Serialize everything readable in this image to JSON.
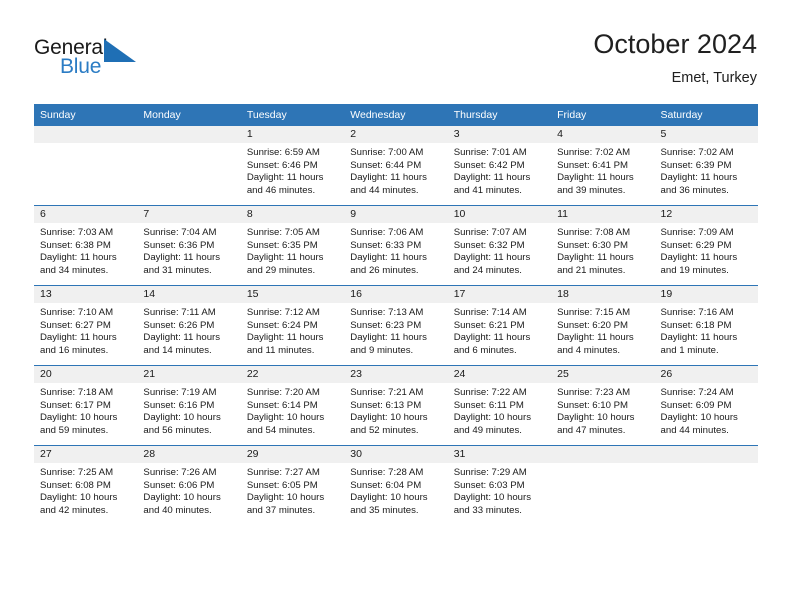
{
  "logo": {
    "word1": "General",
    "word2": "Blue",
    "triangle_color": "#1f6fb5",
    "word1_color": "#1a1a1a",
    "word2_color": "#2b7cc4"
  },
  "header": {
    "title": "October 2024",
    "subtitle": "Emet, Turkey"
  },
  "theme": {
    "header_blue": "#2e75b6",
    "daynum_band": "#f0f0f0",
    "text": "#1a1a1a"
  },
  "columns": [
    "Sunday",
    "Monday",
    "Tuesday",
    "Wednesday",
    "Thursday",
    "Friday",
    "Saturday"
  ],
  "weeks": [
    [
      {
        "day": "",
        "blank": true
      },
      {
        "day": "",
        "blank": true
      },
      {
        "day": "1",
        "sunrise": "Sunrise: 6:59 AM",
        "sunset": "Sunset: 6:46 PM",
        "daylight": "Daylight: 11 hours and 46 minutes."
      },
      {
        "day": "2",
        "sunrise": "Sunrise: 7:00 AM",
        "sunset": "Sunset: 6:44 PM",
        "daylight": "Daylight: 11 hours and 44 minutes."
      },
      {
        "day": "3",
        "sunrise": "Sunrise: 7:01 AM",
        "sunset": "Sunset: 6:42 PM",
        "daylight": "Daylight: 11 hours and 41 minutes."
      },
      {
        "day": "4",
        "sunrise": "Sunrise: 7:02 AM",
        "sunset": "Sunset: 6:41 PM",
        "daylight": "Daylight: 11 hours and 39 minutes."
      },
      {
        "day": "5",
        "sunrise": "Sunrise: 7:02 AM",
        "sunset": "Sunset: 6:39 PM",
        "daylight": "Daylight: 11 hours and 36 minutes."
      }
    ],
    [
      {
        "day": "6",
        "sunrise": "Sunrise: 7:03 AM",
        "sunset": "Sunset: 6:38 PM",
        "daylight": "Daylight: 11 hours and 34 minutes."
      },
      {
        "day": "7",
        "sunrise": "Sunrise: 7:04 AM",
        "sunset": "Sunset: 6:36 PM",
        "daylight": "Daylight: 11 hours and 31 minutes."
      },
      {
        "day": "8",
        "sunrise": "Sunrise: 7:05 AM",
        "sunset": "Sunset: 6:35 PM",
        "daylight": "Daylight: 11 hours and 29 minutes."
      },
      {
        "day": "9",
        "sunrise": "Sunrise: 7:06 AM",
        "sunset": "Sunset: 6:33 PM",
        "daylight": "Daylight: 11 hours and 26 minutes."
      },
      {
        "day": "10",
        "sunrise": "Sunrise: 7:07 AM",
        "sunset": "Sunset: 6:32 PM",
        "daylight": "Daylight: 11 hours and 24 minutes."
      },
      {
        "day": "11",
        "sunrise": "Sunrise: 7:08 AM",
        "sunset": "Sunset: 6:30 PM",
        "daylight": "Daylight: 11 hours and 21 minutes."
      },
      {
        "day": "12",
        "sunrise": "Sunrise: 7:09 AM",
        "sunset": "Sunset: 6:29 PM",
        "daylight": "Daylight: 11 hours and 19 minutes."
      }
    ],
    [
      {
        "day": "13",
        "sunrise": "Sunrise: 7:10 AM",
        "sunset": "Sunset: 6:27 PM",
        "daylight": "Daylight: 11 hours and 16 minutes."
      },
      {
        "day": "14",
        "sunrise": "Sunrise: 7:11 AM",
        "sunset": "Sunset: 6:26 PM",
        "daylight": "Daylight: 11 hours and 14 minutes."
      },
      {
        "day": "15",
        "sunrise": "Sunrise: 7:12 AM",
        "sunset": "Sunset: 6:24 PM",
        "daylight": "Daylight: 11 hours and 11 minutes."
      },
      {
        "day": "16",
        "sunrise": "Sunrise: 7:13 AM",
        "sunset": "Sunset: 6:23 PM",
        "daylight": "Daylight: 11 hours and 9 minutes."
      },
      {
        "day": "17",
        "sunrise": "Sunrise: 7:14 AM",
        "sunset": "Sunset: 6:21 PM",
        "daylight": "Daylight: 11 hours and 6 minutes."
      },
      {
        "day": "18",
        "sunrise": "Sunrise: 7:15 AM",
        "sunset": "Sunset: 6:20 PM",
        "daylight": "Daylight: 11 hours and 4 minutes."
      },
      {
        "day": "19",
        "sunrise": "Sunrise: 7:16 AM",
        "sunset": "Sunset: 6:18 PM",
        "daylight": "Daylight: 11 hours and 1 minute."
      }
    ],
    [
      {
        "day": "20",
        "sunrise": "Sunrise: 7:18 AM",
        "sunset": "Sunset: 6:17 PM",
        "daylight": "Daylight: 10 hours and 59 minutes."
      },
      {
        "day": "21",
        "sunrise": "Sunrise: 7:19 AM",
        "sunset": "Sunset: 6:16 PM",
        "daylight": "Daylight: 10 hours and 56 minutes."
      },
      {
        "day": "22",
        "sunrise": "Sunrise: 7:20 AM",
        "sunset": "Sunset: 6:14 PM",
        "daylight": "Daylight: 10 hours and 54 minutes."
      },
      {
        "day": "23",
        "sunrise": "Sunrise: 7:21 AM",
        "sunset": "Sunset: 6:13 PM",
        "daylight": "Daylight: 10 hours and 52 minutes."
      },
      {
        "day": "24",
        "sunrise": "Sunrise: 7:22 AM",
        "sunset": "Sunset: 6:11 PM",
        "daylight": "Daylight: 10 hours and 49 minutes."
      },
      {
        "day": "25",
        "sunrise": "Sunrise: 7:23 AM",
        "sunset": "Sunset: 6:10 PM",
        "daylight": "Daylight: 10 hours and 47 minutes."
      },
      {
        "day": "26",
        "sunrise": "Sunrise: 7:24 AM",
        "sunset": "Sunset: 6:09 PM",
        "daylight": "Daylight: 10 hours and 44 minutes."
      }
    ],
    [
      {
        "day": "27",
        "sunrise": "Sunrise: 7:25 AM",
        "sunset": "Sunset: 6:08 PM",
        "daylight": "Daylight: 10 hours and 42 minutes."
      },
      {
        "day": "28",
        "sunrise": "Sunrise: 7:26 AM",
        "sunset": "Sunset: 6:06 PM",
        "daylight": "Daylight: 10 hours and 40 minutes."
      },
      {
        "day": "29",
        "sunrise": "Sunrise: 7:27 AM",
        "sunset": "Sunset: 6:05 PM",
        "daylight": "Daylight: 10 hours and 37 minutes."
      },
      {
        "day": "30",
        "sunrise": "Sunrise: 7:28 AM",
        "sunset": "Sunset: 6:04 PM",
        "daylight": "Daylight: 10 hours and 35 minutes."
      },
      {
        "day": "31",
        "sunrise": "Sunrise: 7:29 AM",
        "sunset": "Sunset: 6:03 PM",
        "daylight": "Daylight: 10 hours and 33 minutes."
      },
      {
        "day": "",
        "blank": true
      },
      {
        "day": "",
        "blank": true
      }
    ]
  ]
}
